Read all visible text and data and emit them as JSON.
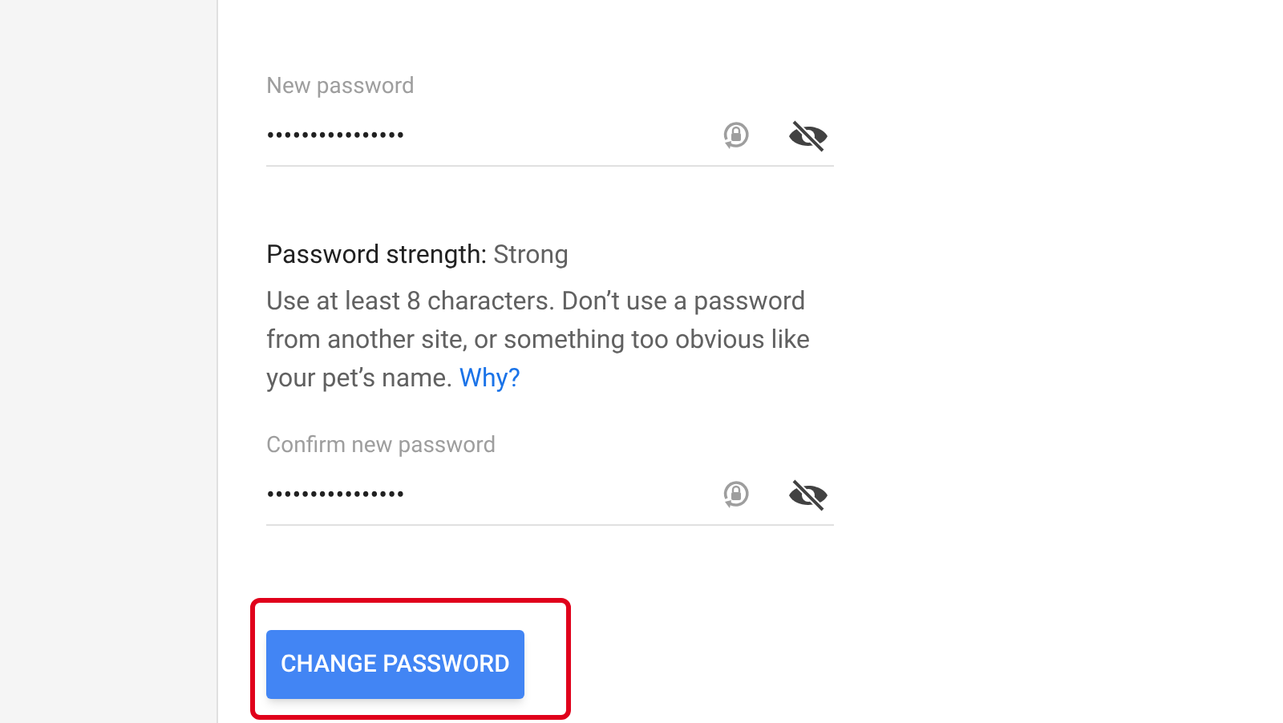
{
  "fields": [
    {
      "label": "New password",
      "value": "••••••••••••••••"
    },
    {
      "label": "Confirm new password",
      "value": "••••••••••••••••"
    }
  ],
  "strength": {
    "label": "Password strength:",
    "value": "Strong"
  },
  "help": {
    "text": "Use at least 8 characters. Don’t use a password from another site, or something too obvious like your pet’s name.",
    "link": "Why?"
  },
  "button": {
    "label": "CHANGE PASSWORD",
    "highlighted": true
  }
}
